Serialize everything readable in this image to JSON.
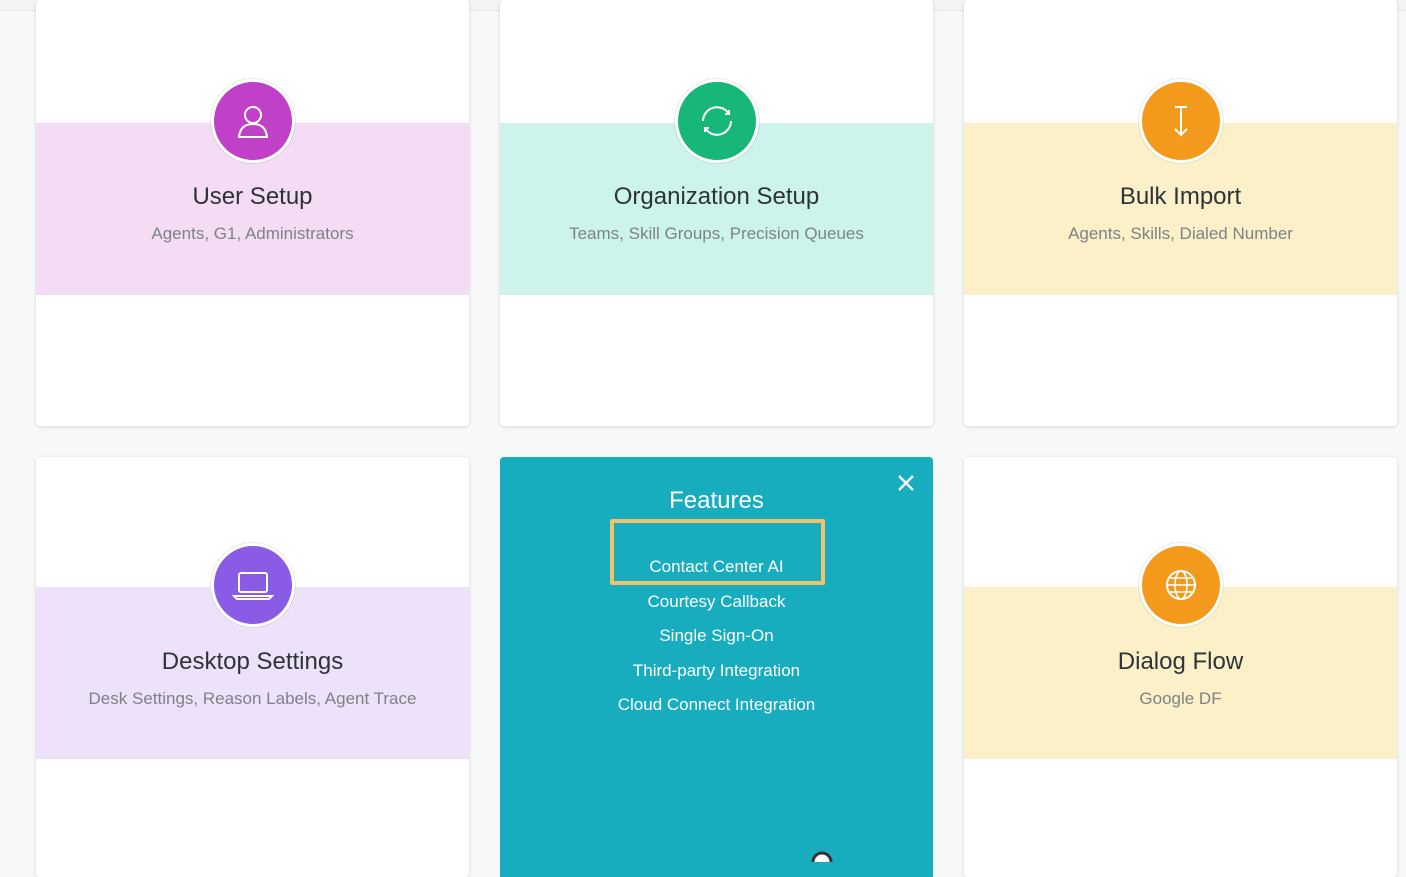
{
  "cards": [
    {
      "title": "User Setup",
      "subtitle": "Agents, G1, Administrators",
      "icon": "user-icon",
      "icon_color": "#c040c8",
      "band_color": "#f4dcf5"
    },
    {
      "title": "Organization Setup",
      "subtitle": "Teams, Skill Groups, Precision Queues",
      "icon": "refresh-icon",
      "icon_color": "#17b77a",
      "band_color": "#cdf4ec"
    },
    {
      "title": "Bulk Import",
      "subtitle": "Agents, Skills, Dialed Number",
      "icon": "import-arrow-icon",
      "icon_color": "#f39a1c",
      "band_color": "#fbf0c7"
    },
    {
      "title": "Desktop Settings",
      "subtitle": "Desk Settings, Reason Labels, Agent Trace",
      "icon": "laptop-icon",
      "icon_color": "#8a5ce6",
      "band_color": "#ede2fa"
    },
    {
      "title": "Dialog Flow",
      "subtitle": "Google DF",
      "icon": "globe-icon",
      "icon_color": "#f39a1c",
      "band_color": "#fbf0c7"
    }
  ],
  "features": {
    "title": "Features",
    "background": "#17adbf",
    "highlight_color": "#f0c36a",
    "close_icon": "close-icon",
    "items": [
      "Contact Center AI",
      "Courtesy Callback",
      "Single Sign-On",
      "Third-party Integration",
      "Cloud Connect Integration"
    ]
  }
}
